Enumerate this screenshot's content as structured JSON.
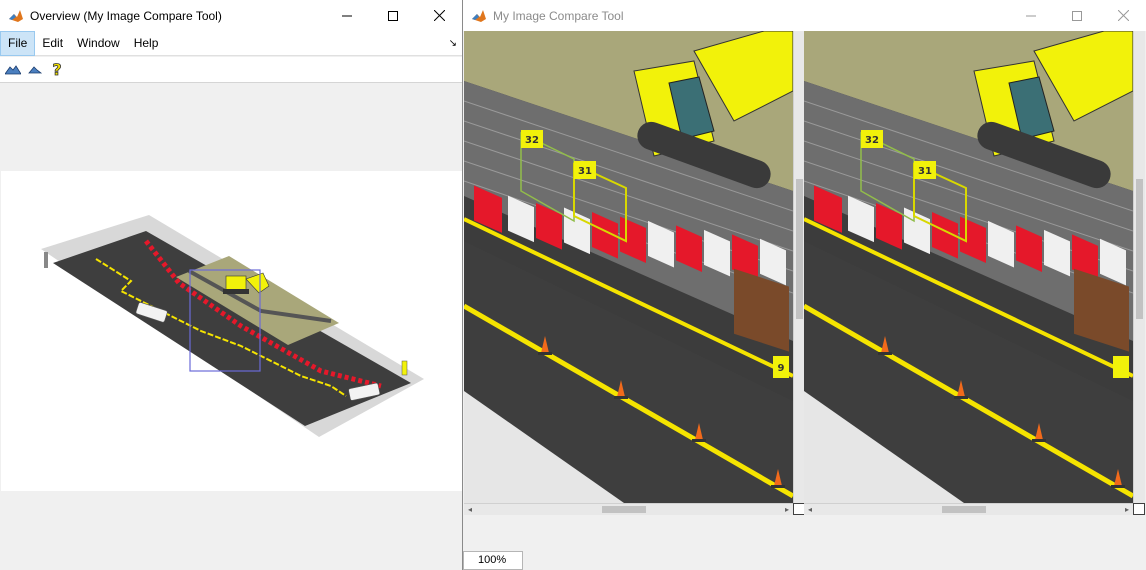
{
  "overview": {
    "title": "Overview (My Image Compare Tool)",
    "menu": [
      "File",
      "Edit",
      "Window",
      "Help"
    ],
    "menu_corner": "↘",
    "toolbar": [
      "mountain-large-icon",
      "mountain-small-icon",
      "help-icon"
    ]
  },
  "compare": {
    "title": "My Image Compare Tool",
    "zoom": "100%",
    "labels": {
      "box_a": "32",
      "box_b": "31",
      "edge_marker": "9"
    }
  },
  "colors": {
    "accent": "#cce4f7",
    "excavator": "#f2f20a",
    "asphalt": "#3e3e3e",
    "lane": "#f5e400",
    "barrier_red": "#e5182a",
    "dirt": "#a9a77a",
    "viewport_box": "#6b6bd8"
  }
}
